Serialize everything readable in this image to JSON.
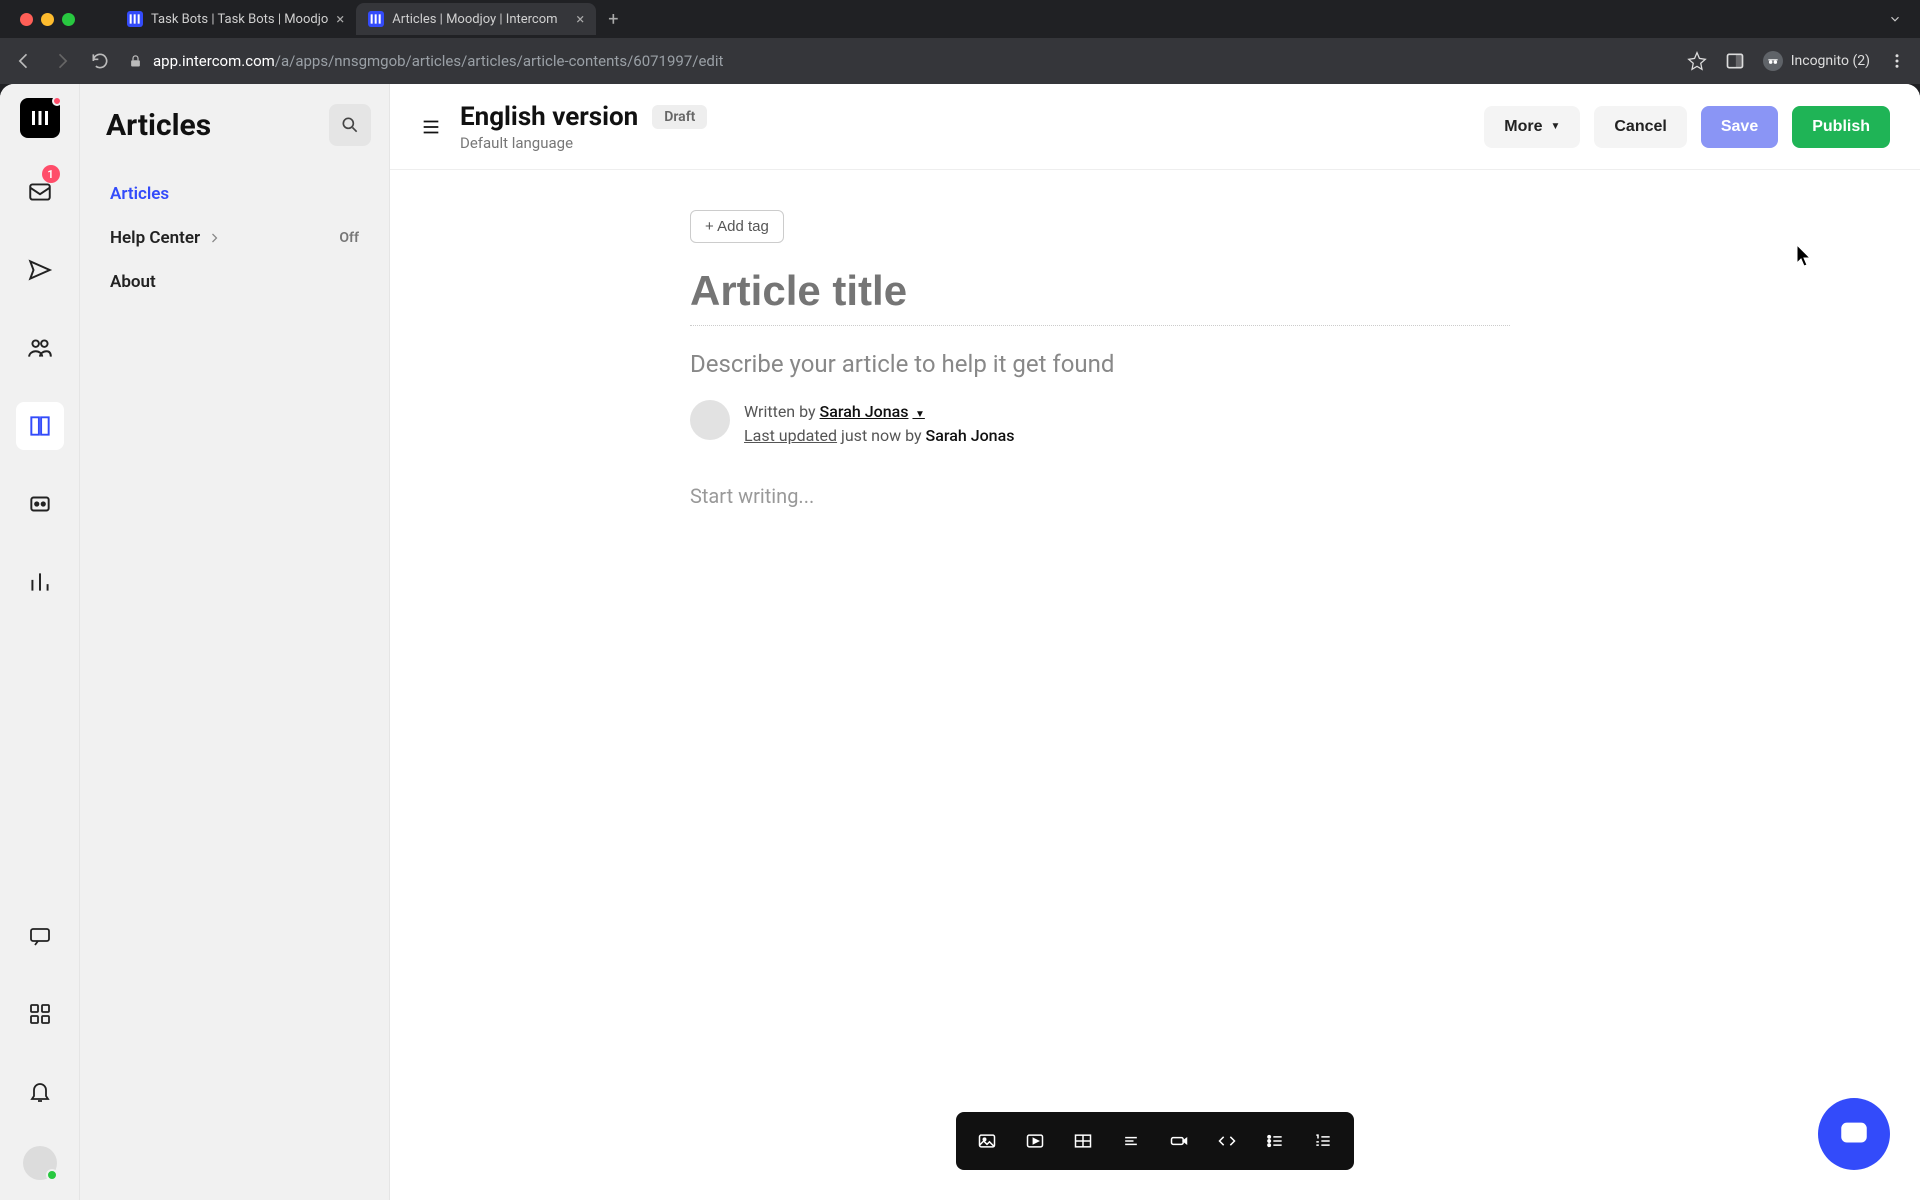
{
  "browser": {
    "tabs": [
      {
        "title": "Task Bots | Task Bots | Moodjo",
        "active": false
      },
      {
        "title": "Articles | Moodjoy | Intercom",
        "active": true
      }
    ],
    "url_host": "app.intercom.com",
    "url_path": "/a/apps/nnsgmgob/articles/articles/article-contents/6071997/edit",
    "incognito_label": "Incognito (2)"
  },
  "rail": {
    "inbox_badge": "1"
  },
  "sidebar": {
    "title": "Articles",
    "items": {
      "articles": "Articles",
      "help_center": "Help Center",
      "help_center_status": "Off",
      "about": "About"
    }
  },
  "header": {
    "title": "English version",
    "badge": "Draft",
    "subtitle": "Default language",
    "actions": {
      "more": "More",
      "cancel": "Cancel",
      "save": "Save",
      "publish": "Publish"
    }
  },
  "editor": {
    "add_tag": "+ Add tag",
    "title_placeholder": "Article title",
    "description_placeholder": "Describe your article to help it get found",
    "byline": {
      "written_by": "Written by ",
      "author": "Sarah Jonas",
      "last_updated": "Last updated",
      "updated_suffix": " just now by ",
      "updater": "Sarah Jonas"
    },
    "content_placeholder": "Start writing..."
  },
  "toolbar_icons": [
    "image",
    "video",
    "table",
    "align",
    "button",
    "code",
    "list-ul",
    "list-ol"
  ]
}
